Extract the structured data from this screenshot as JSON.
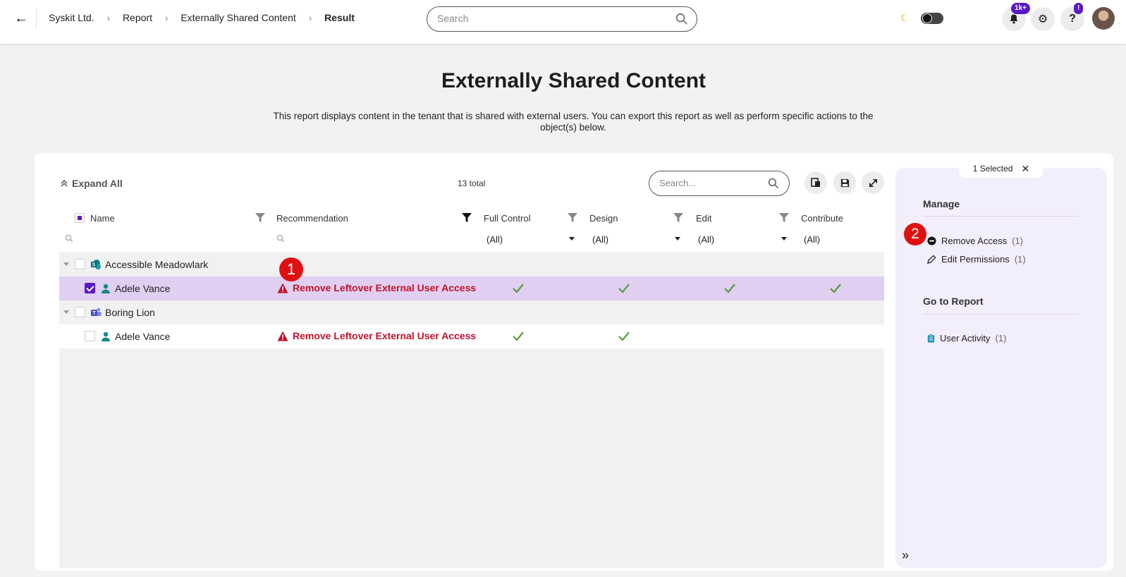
{
  "topbar": {
    "breadcrumbs": [
      "Syskit Ltd.",
      "Report",
      "Externally Shared Content",
      "Result"
    ],
    "search_placeholder": "Search",
    "notifications_badge": "1k+",
    "help_badge": "!"
  },
  "page": {
    "title": "Externally Shared Content",
    "description": "This report displays content in the tenant that is shared with external users. You can export this report as well as perform specific actions to the object(s) below."
  },
  "toolbar": {
    "expand_all": "Expand All",
    "total": "13 total",
    "search_placeholder": "Search..."
  },
  "grid": {
    "columns": {
      "name": "Name",
      "recommendation": "Recommendation",
      "full_control": "Full Control",
      "design": "Design",
      "edit": "Edit",
      "contribute": "Contribute"
    },
    "filter_all": "(All)",
    "rows": [
      {
        "type": "group",
        "label": "Accessible Meadowlark"
      },
      {
        "type": "item",
        "label": "Adele Vance",
        "recommendation": "Remove Leftover External User Access",
        "selected": true,
        "full_control": true,
        "design": true,
        "edit": true,
        "contribute": true
      },
      {
        "type": "group",
        "label": "Boring Lion"
      },
      {
        "type": "item",
        "label": "Adele Vance",
        "recommendation": "Remove Leftover External User Access",
        "selected": false,
        "full_control": true,
        "design": true,
        "edit": false,
        "contribute": false
      }
    ]
  },
  "markers": [
    "1",
    "2"
  ],
  "side_panel": {
    "selected_label": "1 Selected",
    "manage_heading": "Manage",
    "manage_items": [
      {
        "label": "Remove Access",
        "count": "(1)"
      },
      {
        "label": "Edit Permissions",
        "count": "(1)"
      }
    ],
    "report_heading": "Go to Report",
    "report_items": [
      {
        "label": "User Activity",
        "count": "(1)"
      }
    ]
  },
  "colors": {
    "accent": "#5a18c8",
    "danger": "#c3122a",
    "success": "#5a9a3a",
    "selected_row": "#e0cff0"
  }
}
